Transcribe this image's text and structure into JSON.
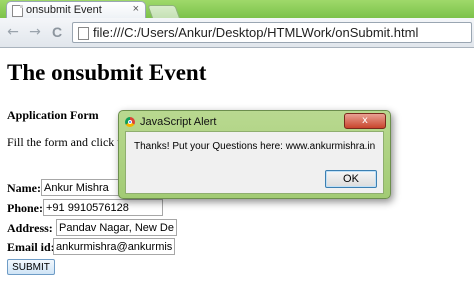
{
  "browser": {
    "tab_title": "onsubmit Event",
    "tab_close": "×",
    "back_icon": "←",
    "forward_icon": "→",
    "reload_icon": "C",
    "url": "file:///C:/Users/Ankur/Desktop/HTMLWork/onSubmit.html",
    "chrome_color": "#7cc24a"
  },
  "page": {
    "heading": "The onsubmit Event",
    "subheading": "Application Form",
    "instruction": "Fill the form and click the",
    "form": {
      "name_label": "Name:",
      "name_value": "Ankur Mishra",
      "phone_label": "Phone:",
      "phone_value": "+91 9910576128",
      "address_label": "Address:",
      "address_value": "Pandav Nagar, New Delhi",
      "email_label": "Email id:",
      "email_value": "ankurmishra@ankurmishr",
      "submit_label": "SUBMIT"
    }
  },
  "alert": {
    "title": "JavaScript Alert",
    "close_glyph": "x",
    "message": "Thanks! Put your Questions here:  www.ankurmishra.in",
    "ok_label": "OK"
  }
}
